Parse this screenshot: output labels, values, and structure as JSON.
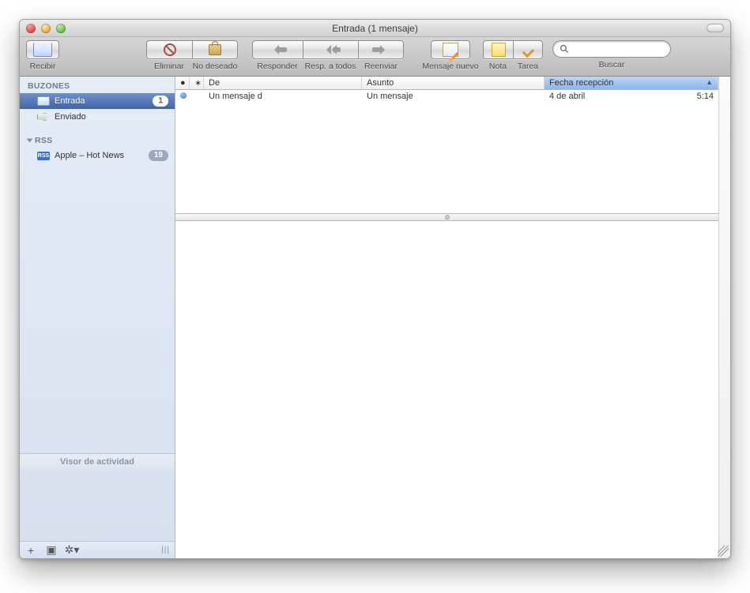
{
  "window": {
    "title": "Entrada (1 mensaje)"
  },
  "toolbar": {
    "receive": "Recibir",
    "delete": "Eliminar",
    "junk": "No deseado",
    "reply": "Responder",
    "reply_all": "Resp. a todos",
    "forward": "Reenviar",
    "compose": "Mensaje nuevo",
    "note": "Nota",
    "todo": "Tarea",
    "search": "Buscar"
  },
  "sidebar": {
    "section_mailboxes": "BUZONES",
    "section_rss": "RSS",
    "items": {
      "inbox": {
        "label": "Entrada",
        "badge": "1"
      },
      "sent": {
        "label": "Enviado"
      },
      "rss0": {
        "label": "Apple – Hot News",
        "badge": "19"
      }
    },
    "activity_header": "Visor de actividad"
  },
  "columns": {
    "status": "●",
    "flag": "✶",
    "from": "De",
    "subject": "Asunto",
    "received": "Fecha recepción"
  },
  "messages": [
    {
      "from": "Un mensaje d",
      "subject": "Un mensaje",
      "date": "4 de abril",
      "time": "5:14",
      "unread": true
    }
  ]
}
